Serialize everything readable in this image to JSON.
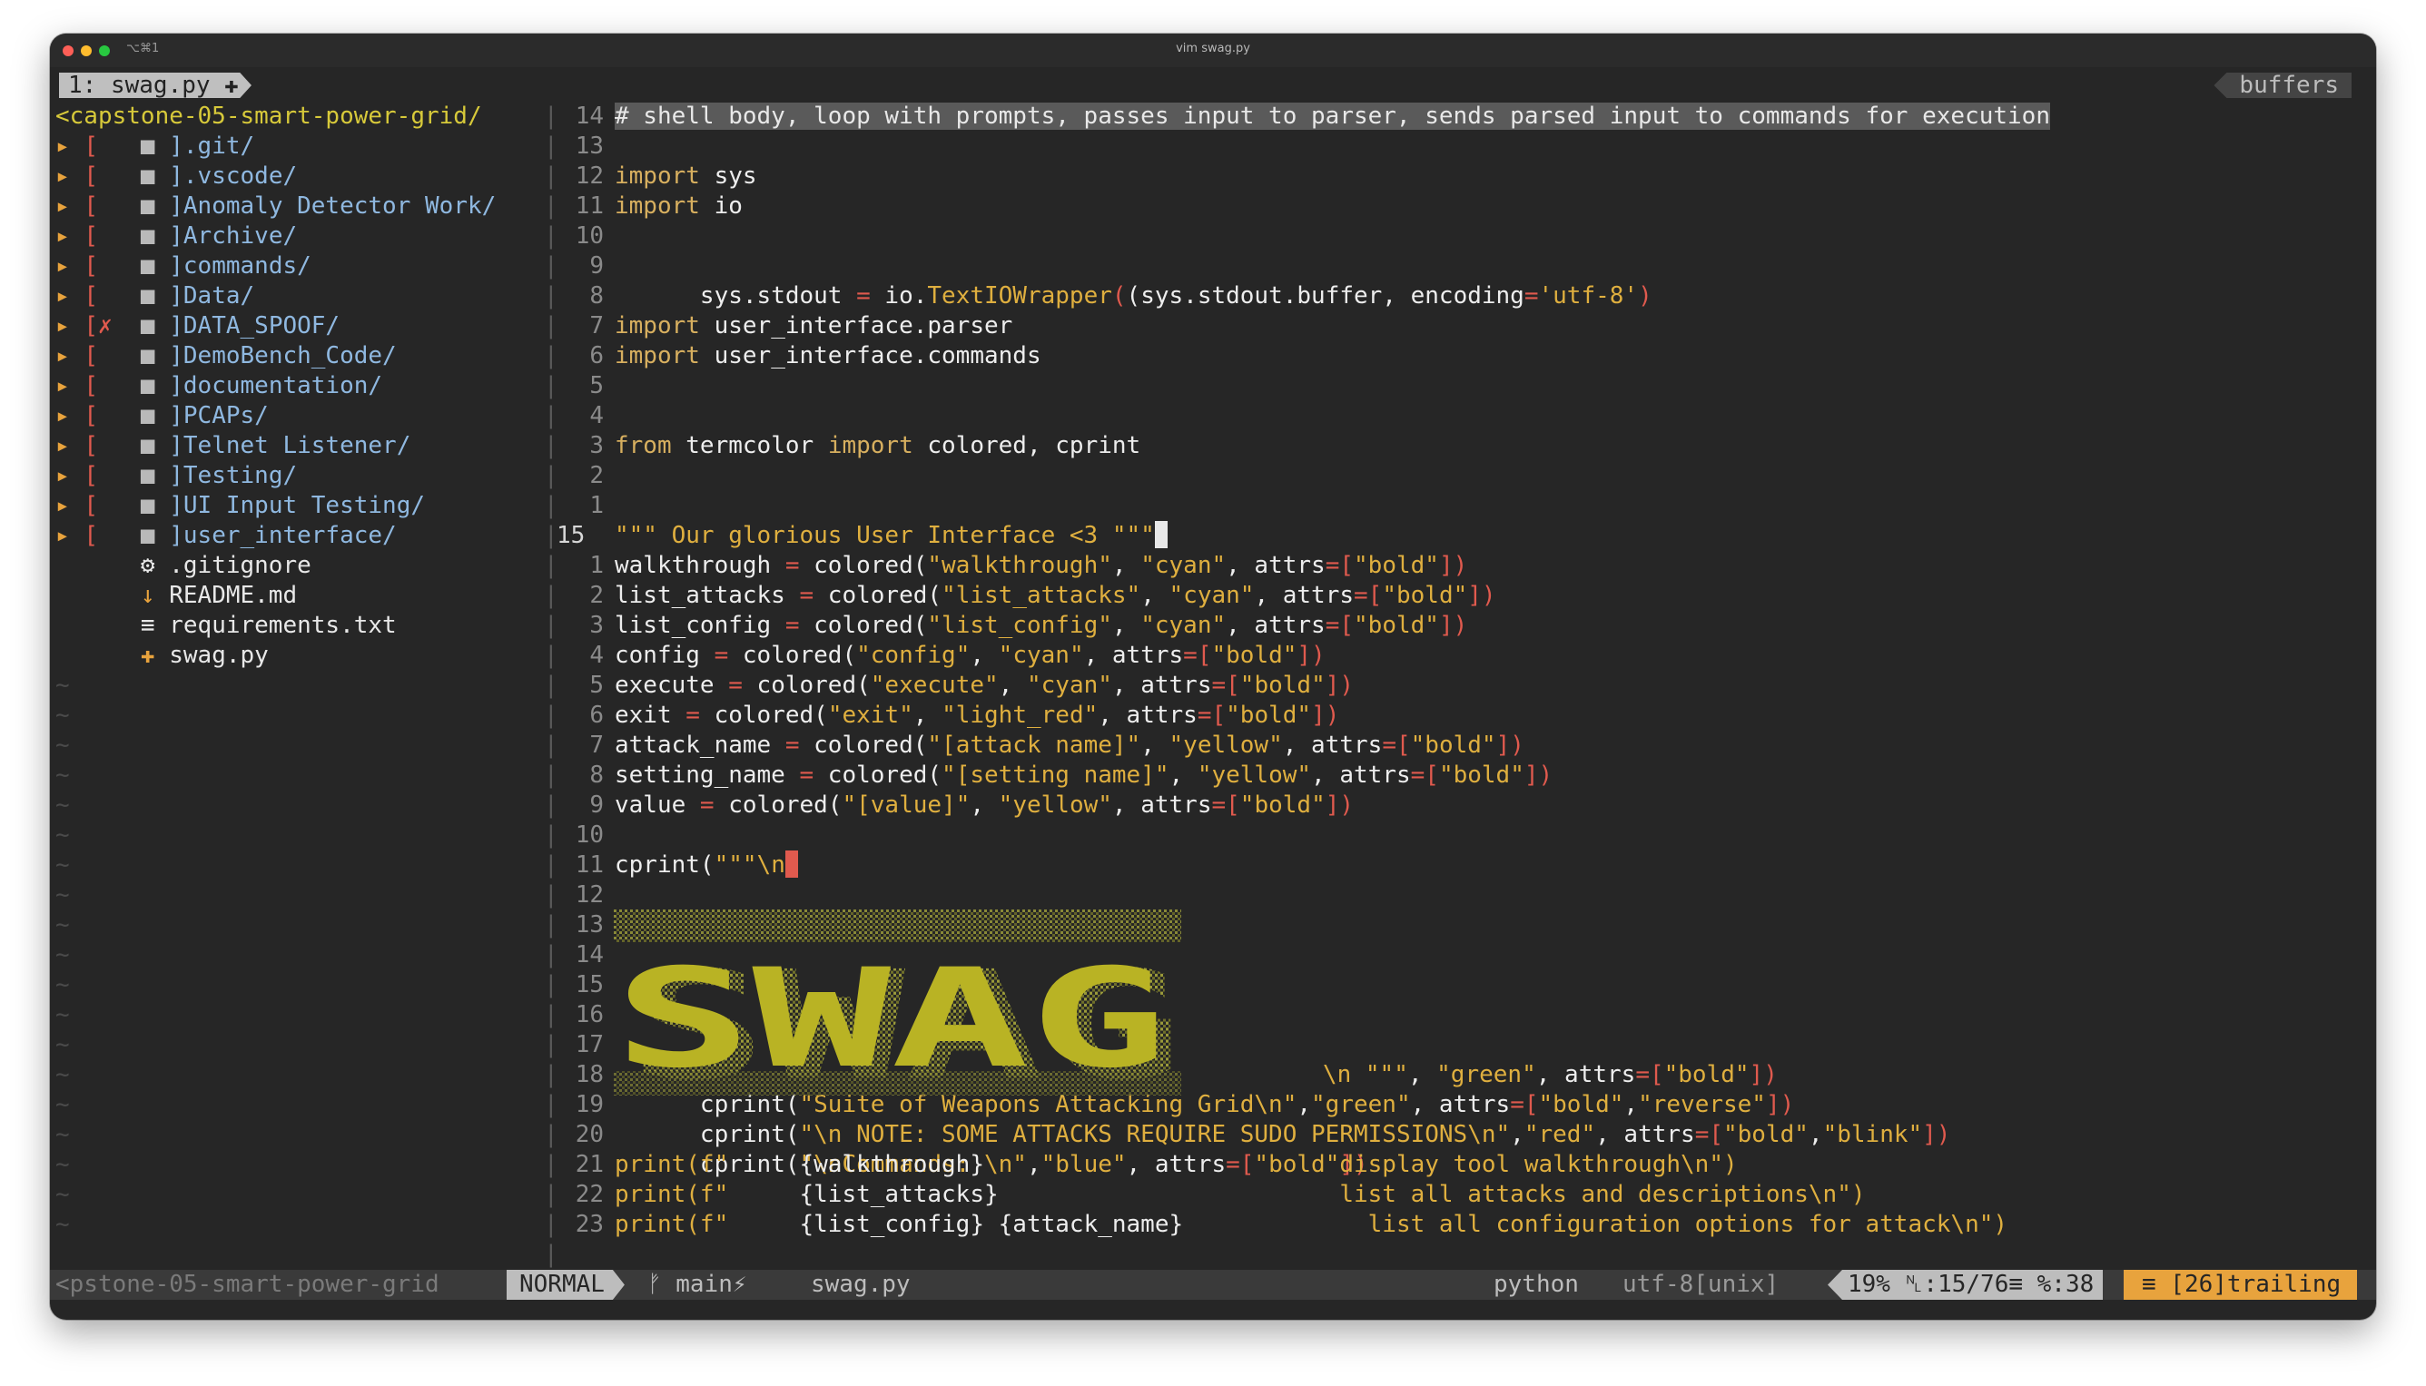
{
  "window": {
    "title": "vim swag.py",
    "shortcut": "⌥⌘1",
    "traffic_colors": [
      "#fe5f57",
      "#febc2e",
      "#28c840"
    ]
  },
  "bufferline": {
    "tab": "1: swag.py ✚",
    "buffers_label": "buffers"
  },
  "tree": {
    "root": "<capstone-05-smart-power-grid/",
    "dirs": [
      {
        "mark": "[ ",
        "name": "].git/"
      },
      {
        "mark": "[ ",
        "name": "].vscode/"
      },
      {
        "mark": "[ ",
        "name": "]Anomaly Detector Work/"
      },
      {
        "mark": "[ ",
        "name": "]Archive/"
      },
      {
        "mark": "[ ",
        "name": "]commands/"
      },
      {
        "mark": "[ ",
        "name": "]Data/"
      },
      {
        "mark": "[✗",
        "name": "]DATA_SPOOF/"
      },
      {
        "mark": "[ ",
        "name": "]DemoBench_Code/"
      },
      {
        "mark": "[ ",
        "name": "]documentation/"
      },
      {
        "mark": "[ ",
        "name": "]PCAPs/"
      },
      {
        "mark": "[ ",
        "name": "]Telnet Listener/"
      },
      {
        "mark": "[ ",
        "name": "]Testing/"
      },
      {
        "mark": "[ ",
        "name": "]UI Input Testing/"
      },
      {
        "mark": "[ ",
        "name": "]user_interface/"
      }
    ],
    "files": [
      {
        "icon": "⚙",
        "name": ".gitignore"
      },
      {
        "icon": "↓",
        "name": "README.md"
      },
      {
        "icon": "≡",
        "name": "requirements.txt"
      },
      {
        "icon": "✚",
        "name": "swag.py"
      }
    ],
    "tilde": "~"
  },
  "gutter": [
    "14",
    "13",
    "12",
    "11",
    "10",
    "9",
    "8",
    "7",
    "6",
    "5",
    "4",
    "3",
    "2",
    "1",
    "15",
    "1",
    "2",
    "3",
    "4",
    "5",
    "6",
    "7",
    "8",
    "9",
    "10",
    "11",
    "12",
    "13",
    "14",
    "15",
    "16",
    "17",
    "18",
    "19",
    "20",
    "21",
    "22",
    "23"
  ],
  "code": {
    "l0": "# shell body, loop with prompts, passes input to parser, sends parsed input to commands for execution",
    "l2a": "import",
    "l2b": " sys",
    "l3a": "import",
    "l3b": " io",
    "l5": [
      "sys.stdout ",
      "=",
      " io.",
      "TextIOWrapper",
      "(sys.stdout.buffer, encoding",
      "=",
      "'utf-8'",
      ")"
    ],
    "l7a": "import",
    "l7b": " user_interface.parser",
    "l8a": "import",
    "l8b": " user_interface.commands",
    "l11": [
      "from",
      " termcolor ",
      "import",
      " colored, cprint"
    ],
    "l14": "\"\"\" Our glorious User Interface <3 \"\"\"",
    "l15": [
      "walkthrough ",
      "=",
      " colored(",
      "\"walkthrough\"",
      ", ",
      "\"cyan\"",
      ", attrs",
      "=[",
      "\"bold\"",
      "])"
    ],
    "l16": [
      "list_attacks ",
      "=",
      " colored(",
      "\"list_attacks\"",
      ", ",
      "\"cyan\"",
      ", attrs",
      "=[",
      "\"bold\"",
      "])"
    ],
    "l17": [
      "list_config ",
      "=",
      " colored(",
      "\"list_config\"",
      ", ",
      "\"cyan\"",
      ", attrs",
      "=[",
      "\"bold\"",
      "])"
    ],
    "l18": [
      "config ",
      "=",
      " colored(",
      "\"config\"",
      ", ",
      "\"cyan\"",
      ", attrs",
      "=[",
      "\"bold\"",
      "])"
    ],
    "l19": [
      "execute ",
      "=",
      " colored(",
      "\"execute\"",
      ", ",
      "\"cyan\"",
      ", attrs",
      "=[",
      "\"bold\"",
      "])"
    ],
    "l20": [
      "exit ",
      "=",
      " colored(",
      "\"exit\"",
      ", ",
      "\"light_red\"",
      ", attrs",
      "=[",
      "\"bold\"",
      "])"
    ],
    "l21": [
      "attack_name ",
      "=",
      " colored(",
      "\"[attack name]\"",
      ", ",
      "\"yellow\"",
      ", attrs",
      "=[",
      "\"bold\"",
      "])"
    ],
    "l22": [
      "setting_name ",
      "=",
      " colored(",
      "\"[setting name]\"",
      ", ",
      "\"yellow\"",
      ", attrs",
      "=[",
      "\"bold\"",
      "])"
    ],
    "l23": [
      "value ",
      "=",
      " colored(",
      "\"[value]\"",
      ", ",
      "\"yellow\"",
      ", attrs",
      "=[",
      "\"bold\"",
      "])"
    ],
    "l25a": "cprint(",
    "l25b": "\"\"\"\\n",
    "art_text": "SWAG",
    "l31": [
      "\\n \"\"\"",
      ", ",
      "\"green\"",
      ", attrs",
      "=[",
      "\"bold\"",
      "])"
    ],
    "l32": [
      "cprint(",
      "\"Suite of Weapons Attacking Grid\\n\"",
      ",",
      "\"green\"",
      ", attrs",
      "=[",
      "\"bold\"",
      ",",
      "\"reverse\"",
      "])"
    ],
    "l33": [
      "cprint(",
      "\"\\n NOTE: SOME ATTACKS REQUIRE SUDO PERMISSIONS\\n\"",
      ",",
      "\"red\"",
      ", attrs",
      "=[",
      "\"bold\"",
      ",",
      "\"blink\"",
      "])"
    ],
    "l34": [
      "cprint(",
      "\"\\nCommands: \\n\"",
      ",",
      "\"blue\"",
      ", attrs",
      "=[",
      "\"bold\"",
      "])"
    ],
    "l35": [
      "print(",
      "f\"     ",
      "{walkthrough}",
      "                         display tool walkthrough\\n\")"
    ],
    "l36": [
      "print(",
      "f\"     ",
      "{list_attacks}",
      "                        list all attacks and descriptions\\n\")"
    ],
    "l37": [
      "print(",
      "f\"     ",
      "{list_config} {attack_name}",
      "             list all configuration options for attack\\n\")"
    ]
  },
  "statusline": {
    "left": "<pstone-05-smart-power-grid",
    "mode": "NORMAL",
    "branch": "ᚠ main",
    "branch_flag": "⚡",
    "file": "swag.py",
    "filetype": "python",
    "encoding": "utf-8[unix]",
    "percent": "19%",
    "position": "␤:15/76≡ %:38",
    "trailing": "≡ [26]trailing"
  }
}
